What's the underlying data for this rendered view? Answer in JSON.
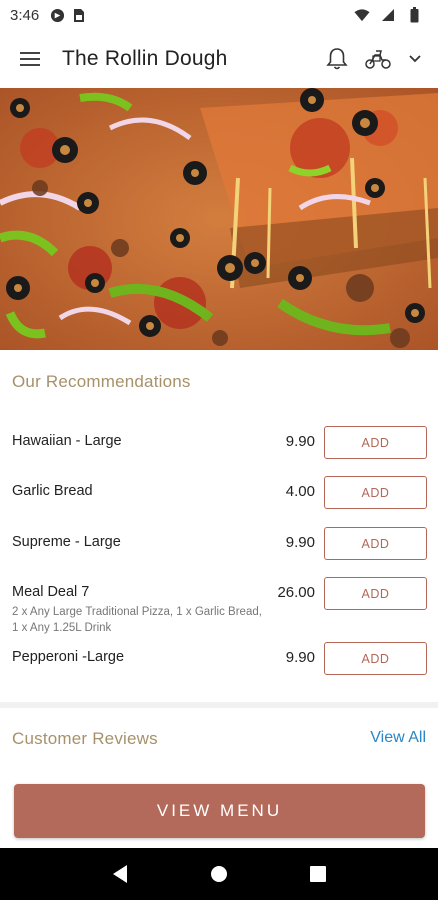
{
  "status_bar": {
    "time": "3:46",
    "icons": [
      "app-notification-icon",
      "sim-card-icon",
      "wifi-icon",
      "signal-icon",
      "battery-icon"
    ]
  },
  "app_bar": {
    "title": "The Rollin Dough",
    "icons": [
      "hamburger-menu-icon",
      "bell-icon",
      "delivery-scooter-icon",
      "chevron-down-icon"
    ]
  },
  "hero": {
    "image": "supreme pizza close-up with a slice being lifted"
  },
  "recommendations": {
    "title": "Our Recommendations",
    "items": [
      {
        "name": "Hawaiian - Large",
        "description": "",
        "price": "9.90",
        "add_label": "ADD"
      },
      {
        "name": "Garlic Bread",
        "description": "",
        "price": "4.00",
        "add_label": "ADD"
      },
      {
        "name": "Supreme - Large",
        "description": "",
        "price": "9.90",
        "add_label": "ADD"
      },
      {
        "name": "Meal Deal 7",
        "description": "2 x Any Large Traditional Pizza, 1 x Garlic Bread, 1 x Any 1.25L Drink",
        "price": "26.00",
        "add_label": "ADD"
      },
      {
        "name": "Pepperoni -Large",
        "description": "",
        "price": "9.90",
        "add_label": "ADD"
      }
    ]
  },
  "reviews": {
    "title": "Customer Reviews",
    "view_all_label": "View All"
  },
  "cta": {
    "label": "VIEW MENU"
  },
  "colors": {
    "accent": "#b46a5a",
    "section_title": "#a7916a",
    "link": "#2a86c8"
  }
}
